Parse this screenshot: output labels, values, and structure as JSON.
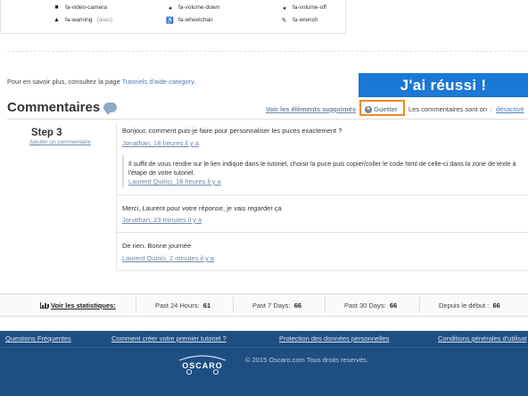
{
  "icon_panel": {
    "cells": [
      {
        "icon": "video-camera-icon",
        "glyph": "■",
        "name": "fa-video-camera",
        "alias": ""
      },
      {
        "icon": "volume-down-icon",
        "glyph": "◂",
        "name": "fa-volume-down",
        "alias": ""
      },
      {
        "icon": "volume-off-icon",
        "glyph": "◂",
        "name": "fa-volume-off",
        "alias": ""
      },
      {
        "icon": "warning-icon",
        "glyph": "▲",
        "name": "fa-warning",
        "alias": "(alias)"
      },
      {
        "icon": "wheelchair-icon",
        "glyph": "♿",
        "name": "fa-wheelchair",
        "alias": ""
      },
      {
        "icon": "wrench-icon",
        "glyph": "✎",
        "name": "fa-wrench",
        "alias": ""
      }
    ]
  },
  "help": {
    "prefix": "Pour en savoir plus, consultez la page ",
    "link": "Tutoriels d'aide category",
    "suffix": "."
  },
  "success_button": "J'ai réussi !",
  "comments": {
    "title": "Commentaires",
    "deleted_link": "Voir les éléments supprimés",
    "watch_button": "Guetter",
    "status_text": "Les commentaires sont on",
    "disable_link": "désactivé"
  },
  "step": {
    "title": "Step 3",
    "add_comment": "Ajouter un commentaire"
  },
  "thread": [
    {
      "text": "Bonjour, comment puis-je faire pour personnaliser les puces exactement ?",
      "meta": "Jonathan, 18 heures il y a",
      "reply": {
        "text": "Il suffit de vous rendre sur le lien indiqué dans le tutoriel, choisir la puce puis copier/coller le code html de celle-ci dans la zone de texte à l'étape de votre tutoriel.",
        "meta": "Laurent Quirici, 18 heures il y a"
      }
    },
    {
      "text": "Merci, Laurent pour votre réponse, je vais regarder ça",
      "meta": "Jonathan, 23 minutes il y a"
    },
    {
      "text": "De rien. Bonne journée",
      "meta": "Laurent Quirici, 2 minutes il y a"
    }
  ],
  "stats": {
    "label": "Voir les statistiques:",
    "items": [
      {
        "label": "Past 24 Hours:",
        "value": "61"
      },
      {
        "label": "Past 7 Days:",
        "value": "66"
      },
      {
        "label": "Past 30 Days:",
        "value": "66"
      },
      {
        "label": "Depuis le début :",
        "value": "66"
      }
    ]
  },
  "footer": {
    "links": [
      "Questions Fréquentes",
      "Comment créer votre premier tutoriel ?",
      "Protection des données personnelles",
      "Conditions générales d'utilisat"
    ],
    "logo_text": "OSCARO",
    "copyright": "© 2015 Oscaro.com Tous droits reservés."
  },
  "colors": {
    "accent_blue": "#1b78d6",
    "highlight_orange": "#f08a24",
    "footer_blue": "#1f4f82",
    "link_blue": "#6f86a5"
  }
}
